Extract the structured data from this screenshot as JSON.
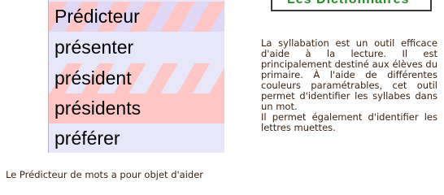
{
  "logo": {
    "text": "Les Dictionnaires"
  },
  "word_list": [
    "Prédicteur",
    "présenter",
    "président",
    "présidents",
    "préférer"
  ],
  "description": {
    "paragraph1": "La syllabation est un outil efficace d'aide à la lecture. Il est principalement destiné aux élèves du primaire. À l'aide de différentes couleurs paramétrables, cet outil permet d'identifier les syllabes dans un mot.",
    "paragraph2": "Il permet également d'identifier les lettres muettes."
  },
  "footer_line": "Le Prédicteur de mots a pour objet d'aider",
  "colors": {
    "syllable_pink": "#ffc6c6",
    "syllable_lavender": "#e7e7f9",
    "body_text": "#3b2414",
    "logo_green": "#2a8a2a"
  }
}
